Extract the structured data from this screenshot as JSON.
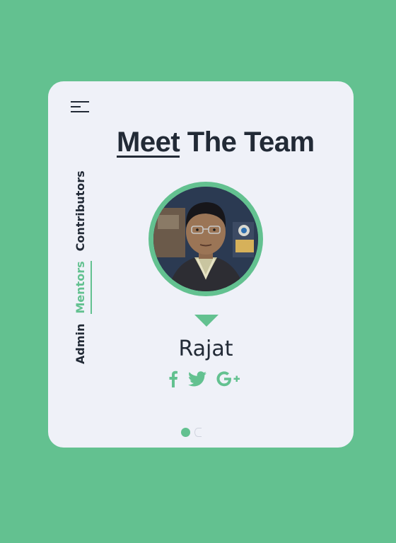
{
  "card": {
    "title_first": "Meet",
    "title_rest": " The Team"
  },
  "side_nav": {
    "tabs": [
      {
        "label": "Admin",
        "active": false
      },
      {
        "label": "Mentors",
        "active": true
      },
      {
        "label": "Contributors",
        "active": false
      }
    ]
  },
  "member": {
    "name": "Rajat",
    "socials": [
      {
        "icon": "facebook-icon"
      },
      {
        "icon": "twitter-icon"
      },
      {
        "icon": "google-plus-icon"
      }
    ]
  },
  "carousel": {
    "total_visible_dots": 2,
    "active_index": 0
  },
  "colors": {
    "background": "#63c190",
    "card": "#eff1f8",
    "accent": "#63c190",
    "text": "#222a36"
  }
}
